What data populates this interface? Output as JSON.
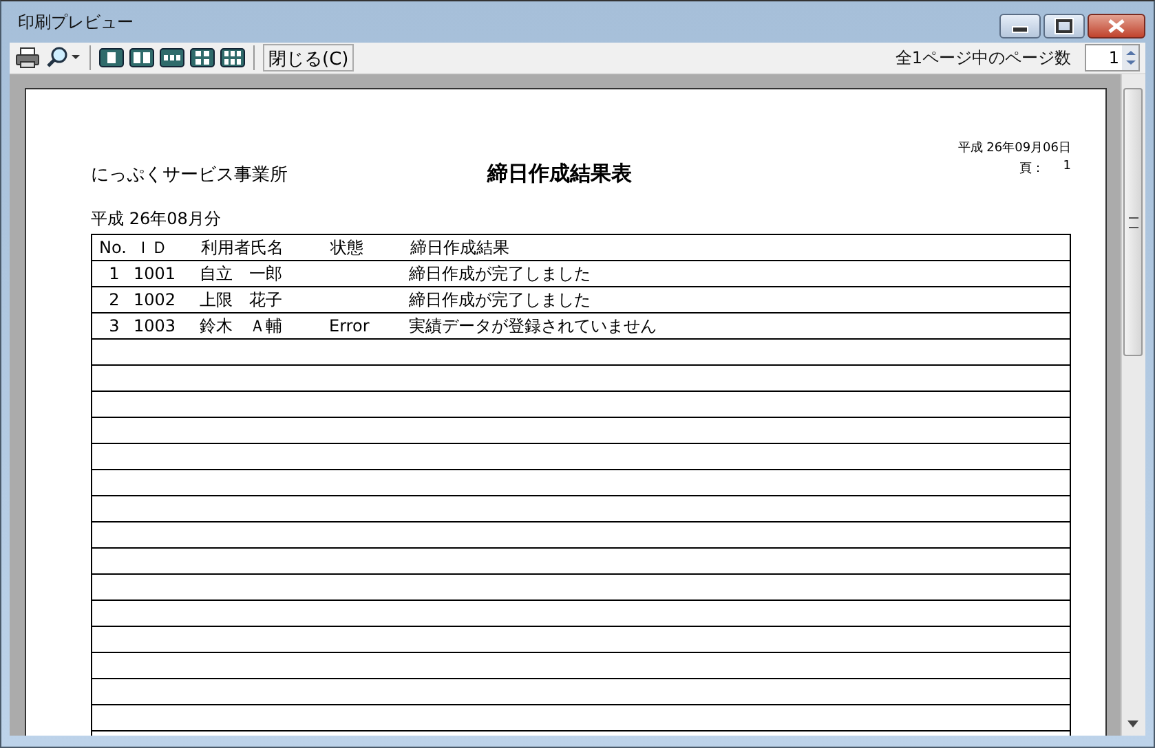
{
  "window": {
    "title": "印刷プレビュー"
  },
  "toolbar": {
    "close_label": "閉じる(C)",
    "page_count_label": "全1ページ中のページ数",
    "page_value": "1"
  },
  "report": {
    "company": "にっぷくサービス事業所",
    "title": "締日作成結果表",
    "date": "平成 26年09月06日",
    "page_label": "頁：",
    "page_number": "1",
    "period": "平成 26年08月分",
    "columns": [
      "No.",
      "ＩＤ",
      "利用者氏名",
      "状態",
      "締日作成結果"
    ],
    "rows": [
      {
        "no": "1",
        "id": "1001",
        "name": "自立　一郎",
        "result": "締日作成が完了しました"
      },
      {
        "no": "2",
        "id": "1002",
        "name": "上限　花子",
        "result": "締日作成が完了しました"
      },
      {
        "no": "3",
        "id": "1003",
        "name": "鈴木　Ａ輔",
        "status": "Error",
        "result": "実績データが登録されていません"
      }
    ]
  }
}
